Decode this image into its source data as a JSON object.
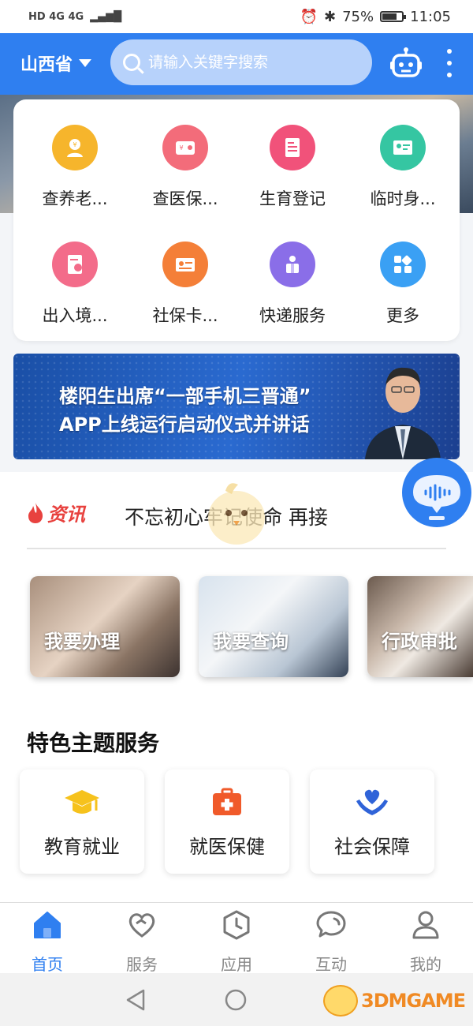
{
  "status_bar": {
    "left_indicators": "HD 4G 4G",
    "battery": "75%",
    "time": "11:05"
  },
  "header": {
    "province": "山西省",
    "search_placeholder": "请输入关键字搜索"
  },
  "services": [
    {
      "label": "查养老...",
      "icon": "pension-icon",
      "color": "#f6b52c"
    },
    {
      "label": "查医保...",
      "icon": "medical-wallet-icon",
      "color": "#f36c7a"
    },
    {
      "label": "生育登记",
      "icon": "document-icon",
      "color": "#f1527a"
    },
    {
      "label": "临时身...",
      "icon": "id-card-icon",
      "color": "#35c6a2"
    },
    {
      "label": "出入境...",
      "icon": "passport-icon",
      "color": "#f36c8a"
    },
    {
      "label": "社保卡...",
      "icon": "social-card-icon",
      "color": "#f47f38"
    },
    {
      "label": "快递服务",
      "icon": "courier-icon",
      "color": "#8a6ee8"
    },
    {
      "label": "更多",
      "icon": "more-grid-icon",
      "color": "#3aa0f4"
    }
  ],
  "banner": {
    "line1": "楼阳生出席“一部手机三晋通”",
    "line2": "APP上线运行启动仪式并讲话"
  },
  "news": {
    "tag": "资讯",
    "headline": "不忘初心牢记使命 再接"
  },
  "quick_actions": [
    {
      "label": "我要办理"
    },
    {
      "label": "我要查询"
    },
    {
      "label": "行政审批"
    }
  ],
  "featured": {
    "title": "特色主题服务",
    "items": [
      {
        "label": "教育就业",
        "icon": "graduation-cap-icon",
        "color": "#f6c21c"
      },
      {
        "label": "就医保健",
        "icon": "medical-kit-icon",
        "color": "#f05a2a"
      },
      {
        "label": "社会保障",
        "icon": "hand-heart-icon",
        "color": "#2f63d8"
      }
    ]
  },
  "tabs": [
    {
      "label": "首页",
      "icon": "home-icon",
      "active": true
    },
    {
      "label": "服务",
      "icon": "heart-service-icon",
      "active": false
    },
    {
      "label": "应用",
      "icon": "clock-hex-icon",
      "active": false
    },
    {
      "label": "互动",
      "icon": "chat-bubble-icon",
      "active": false
    },
    {
      "label": "我的",
      "icon": "user-icon",
      "active": false
    }
  ],
  "watermark": "3DMGAME",
  "colors": {
    "primary": "#2f7ff0",
    "news_red": "#e8423f"
  }
}
